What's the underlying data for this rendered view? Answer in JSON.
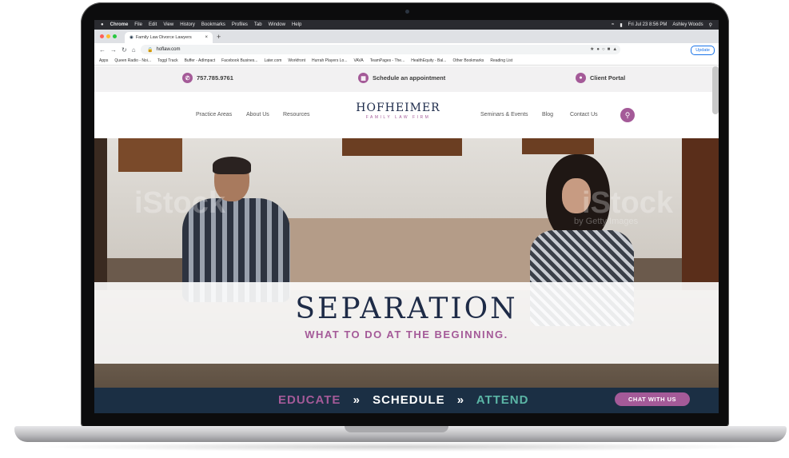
{
  "menubar": {
    "apple": "",
    "items": [
      "Chrome",
      "File",
      "Edit",
      "View",
      "History",
      "Bookmarks",
      "Profiles",
      "Tab",
      "Window",
      "Help"
    ],
    "clock": "Fri Jul 23 8:56 PM",
    "user": "Ashley Woods"
  },
  "browser": {
    "tab_title": "Family Law Divorce Lawyers",
    "tab_close": "×",
    "new_tab": "+",
    "url": "hoflaw.com",
    "update_label": "Update",
    "bookmarks": [
      "Apps",
      "Queen Radio - Noi...",
      "Toggl Track",
      "Buffer - AdImpact",
      "Facebook Busines...",
      "Later.com",
      "Workfront",
      "Hurrah Players Lo...",
      "VAVA",
      "TeamPages - The...",
      "HealthEquity - Bal...",
      "Other Bookmarks",
      "Reading List"
    ]
  },
  "site": {
    "phone": "757.785.9761",
    "schedule": "Schedule an appointment",
    "portal": "Client Portal",
    "nav_left": [
      "Practice Areas",
      "About Us",
      "Resources"
    ],
    "nav_right": [
      "Seminars & Events",
      "Blog",
      "Contact Us"
    ],
    "logo_main": "HOFHEIMER",
    "logo_sub": "FAMILY LAW FIRM",
    "watermark": "iStock",
    "watermark_sub": "by Getty Images",
    "hero_title": "SEPARATION",
    "hero_subtitle": "WHAT TO DO AT THE BEGINNING.",
    "steps": [
      {
        "label": "EDUCATE",
        "color": "#a45a98"
      },
      {
        "label": "SCHEDULE",
        "color": "#ffffff"
      },
      {
        "label": "ATTEND",
        "color": "#5bb6a6"
      }
    ],
    "step_sep": "»",
    "chat": "CHAT WITH US"
  },
  "colors": {
    "accent": "#a45a98",
    "navy": "#1b2f44",
    "teal": "#5bb6a6"
  }
}
